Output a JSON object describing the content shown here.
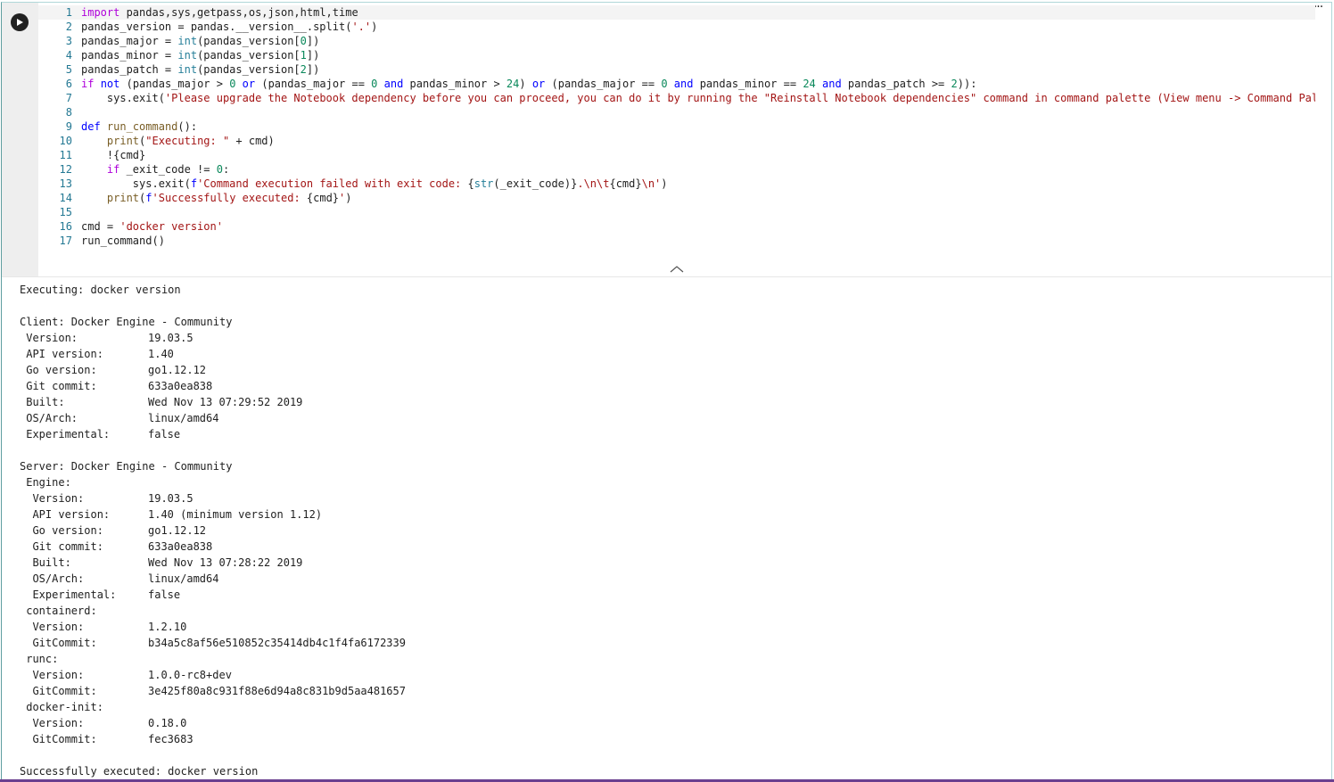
{
  "cell": {
    "run_icon": "play-icon",
    "more_icon": "more-horizontal-icon",
    "more_label": "···",
    "collapse_icon": "chevron-up-icon"
  },
  "code": {
    "lines": [
      {
        "n": "1",
        "parts": [
          [
            "kw-ctrl",
            "import"
          ],
          [
            "",
            ""
          ],
          [
            "",
            " pandas,sys,getpass,os,json,html,time"
          ]
        ]
      },
      {
        "n": "2",
        "parts": [
          [
            "",
            "pandas_version = pandas.__version__.split("
          ],
          [
            "str",
            "'.'"
          ],
          [
            "",
            ")"
          ]
        ]
      },
      {
        "n": "3",
        "parts": [
          [
            "",
            "pandas_major = "
          ],
          [
            "bi",
            "int"
          ],
          [
            "",
            "(pandas_version["
          ],
          [
            "num",
            "0"
          ],
          [
            "",
            "])"
          ]
        ]
      },
      {
        "n": "4",
        "parts": [
          [
            "",
            "pandas_minor = "
          ],
          [
            "bi",
            "int"
          ],
          [
            "",
            "(pandas_version["
          ],
          [
            "num",
            "1"
          ],
          [
            "",
            "])"
          ]
        ]
      },
      {
        "n": "5",
        "parts": [
          [
            "",
            "pandas_patch = "
          ],
          [
            "bi",
            "int"
          ],
          [
            "",
            "(pandas_version["
          ],
          [
            "num",
            "2"
          ],
          [
            "",
            "])"
          ]
        ]
      },
      {
        "n": "6",
        "parts": [
          [
            "kw-ctrl",
            "if"
          ],
          [
            "",
            " "
          ],
          [
            "kw",
            "not"
          ],
          [
            "",
            " (pandas_major > "
          ],
          [
            "num",
            "0"
          ],
          [
            "",
            " "
          ],
          [
            "kw",
            "or"
          ],
          [
            "",
            " (pandas_major == "
          ],
          [
            "num",
            "0"
          ],
          [
            "",
            " "
          ],
          [
            "kw",
            "and"
          ],
          [
            "",
            " pandas_minor > "
          ],
          [
            "num",
            "24"
          ],
          [
            "",
            ") "
          ],
          [
            "kw",
            "or"
          ],
          [
            "",
            " (pandas_major == "
          ],
          [
            "num",
            "0"
          ],
          [
            "",
            " "
          ],
          [
            "kw",
            "and"
          ],
          [
            "",
            " pandas_minor == "
          ],
          [
            "num",
            "24"
          ],
          [
            "",
            " "
          ],
          [
            "kw",
            "and"
          ],
          [
            "",
            " pandas_patch >= "
          ],
          [
            "num",
            "2"
          ],
          [
            "",
            ")):"
          ]
        ]
      },
      {
        "n": "7",
        "parts": [
          [
            "",
            "    sys.exit("
          ],
          [
            "str",
            "'Please upgrade the Notebook dependency before you can proceed, you can do it by running the \"Reinstall Notebook dependencies\" command in command palette (View menu -> Command Pal"
          ]
        ]
      },
      {
        "n": "8",
        "parts": [
          [
            "",
            ""
          ]
        ]
      },
      {
        "n": "9",
        "parts": [
          [
            "kw",
            "def"
          ],
          [
            "",
            " "
          ],
          [
            "fn",
            "run_command"
          ],
          [
            "",
            "():"
          ]
        ]
      },
      {
        "n": "10",
        "parts": [
          [
            "",
            "    "
          ],
          [
            "fn",
            "print"
          ],
          [
            "",
            "("
          ],
          [
            "str",
            "\"Executing: \""
          ],
          [
            "",
            " + cmd)"
          ]
        ]
      },
      {
        "n": "11",
        "parts": [
          [
            "",
            "    !{cmd}"
          ]
        ]
      },
      {
        "n": "12",
        "parts": [
          [
            "",
            "    "
          ],
          [
            "kw-ctrl",
            "if"
          ],
          [
            "",
            " _exit_code != "
          ],
          [
            "num",
            "0"
          ],
          [
            "",
            ":"
          ]
        ]
      },
      {
        "n": "13",
        "parts": [
          [
            "",
            "        sys.exit("
          ],
          [
            "kw",
            "f"
          ],
          [
            "str",
            "'Command execution failed with exit code: "
          ],
          [
            "",
            "{"
          ],
          [
            "bi",
            "str"
          ],
          [
            "",
            "(_exit_code)}"
          ],
          [
            "str",
            ".\\n\\t"
          ],
          [
            "",
            "{cmd}"
          ],
          [
            "str",
            "\\n'"
          ],
          [
            "",
            ")"
          ]
        ]
      },
      {
        "n": "14",
        "parts": [
          [
            "",
            "    "
          ],
          [
            "fn",
            "print"
          ],
          [
            "",
            "("
          ],
          [
            "kw",
            "f"
          ],
          [
            "str",
            "'Successfully executed: "
          ],
          [
            "",
            "{cmd}"
          ],
          [
            "str",
            "'"
          ],
          [
            "",
            ")"
          ]
        ]
      },
      {
        "n": "15",
        "parts": [
          [
            "",
            ""
          ]
        ]
      },
      {
        "n": "16",
        "parts": [
          [
            "",
            "cmd = "
          ],
          [
            "str",
            "'docker version'"
          ]
        ]
      },
      {
        "n": "17",
        "parts": [
          [
            "",
            "run_command()"
          ]
        ]
      }
    ]
  },
  "output": {
    "lines": [
      {
        "k": "Executing: docker version",
        "v": ""
      },
      {
        "k": "",
        "v": ""
      },
      {
        "k": "Client: Docker Engine - Community",
        "v": ""
      },
      {
        "k": " Version:",
        "v": "19.03.5"
      },
      {
        "k": " API version:",
        "v": "1.40"
      },
      {
        "k": " Go version:",
        "v": "go1.12.12"
      },
      {
        "k": " Git commit:",
        "v": "633a0ea838"
      },
      {
        "k": " Built:",
        "v": "Wed Nov 13 07:29:52 2019"
      },
      {
        "k": " OS/Arch:",
        "v": "linux/amd64"
      },
      {
        "k": " Experimental:",
        "v": "false"
      },
      {
        "k": "",
        "v": ""
      },
      {
        "k": "Server: Docker Engine - Community",
        "v": ""
      },
      {
        "k": " Engine:",
        "v": ""
      },
      {
        "k": "  Version:",
        "v": "19.03.5"
      },
      {
        "k": "  API version:",
        "v": "1.40 (minimum version 1.12)"
      },
      {
        "k": "  Go version:",
        "v": "go1.12.12"
      },
      {
        "k": "  Git commit:",
        "v": "633a0ea838"
      },
      {
        "k": "  Built:",
        "v": "Wed Nov 13 07:28:22 2019"
      },
      {
        "k": "  OS/Arch:",
        "v": "linux/amd64"
      },
      {
        "k": "  Experimental:",
        "v": "false"
      },
      {
        "k": " containerd:",
        "v": ""
      },
      {
        "k": "  Version:",
        "v": "1.2.10"
      },
      {
        "k": "  GitCommit:",
        "v": "b34a5c8af56e510852c35414db4c1f4fa6172339"
      },
      {
        "k": " runc:",
        "v": ""
      },
      {
        "k": "  Version:",
        "v": "1.0.0-rc8+dev"
      },
      {
        "k": "  GitCommit:",
        "v": "3e425f80a8c931f88e6d94a8c831b9d5aa481657"
      },
      {
        "k": " docker-init:",
        "v": ""
      },
      {
        "k": "  Version:",
        "v": "0.18.0"
      },
      {
        "k": "  GitCommit:",
        "v": "fec3683"
      },
      {
        "k": "",
        "v": ""
      },
      {
        "k": "Successfully executed: docker version",
        "v": ""
      }
    ]
  }
}
